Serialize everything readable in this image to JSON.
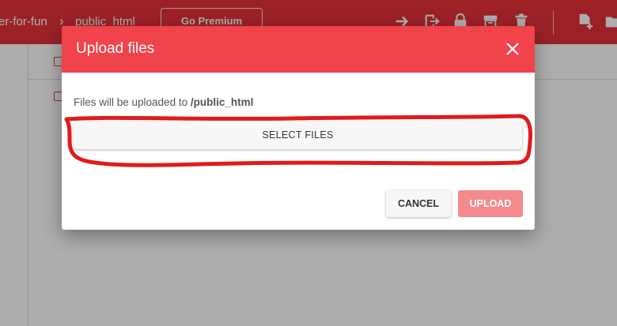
{
  "header": {
    "breadcrumb": [
      "er-for-fun",
      "public_html"
    ],
    "breadcrumb_separator": "›",
    "premium_label": "Go Premium",
    "toolbar_icons": [
      "arrow-right-icon",
      "move-icon",
      "lock-icon",
      "archive-icon",
      "trash-icon",
      "new-file-icon",
      "folder-icon"
    ]
  },
  "dialog": {
    "title": "Upload files",
    "info_prefix": "Files will be uploaded to ",
    "info_path": "/public_html",
    "select_label": "SELECT FILES",
    "cancel_label": "CANCEL",
    "upload_label": "UPLOAD"
  },
  "colors": {
    "topbar": "#e5323a",
    "dialog_header": "#f0434b",
    "upload_disabled": "#f58a8d",
    "annotation": "#e01b1b"
  }
}
